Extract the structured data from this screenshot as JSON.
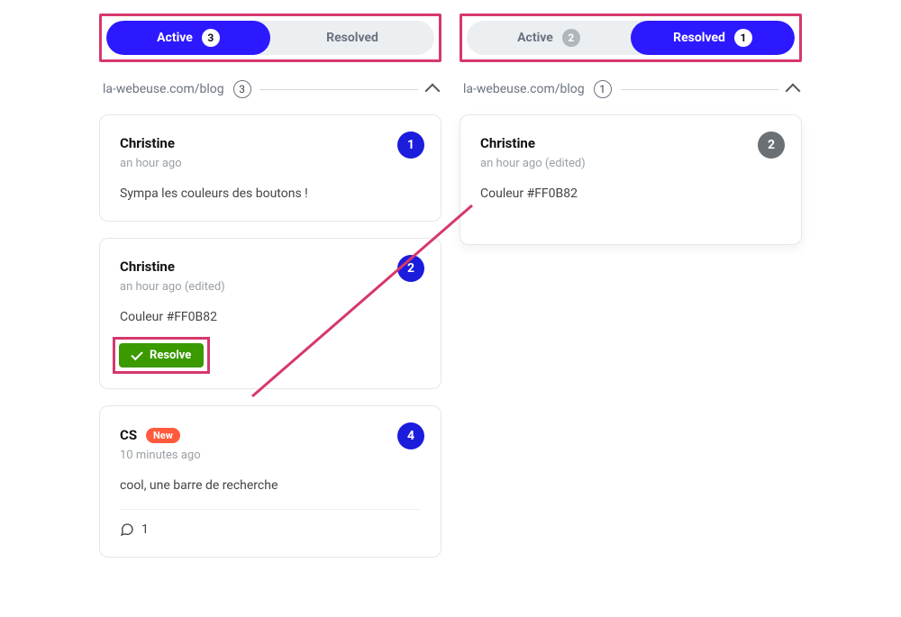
{
  "left": {
    "tabs": {
      "active_label": "Active",
      "active_count": "3",
      "resolved_label": "Resolved"
    },
    "page": {
      "url": "la-webeuse.com/blog",
      "count": "3"
    },
    "cards": [
      {
        "author": "Christine",
        "meta": "an hour ago",
        "body": "Sympa les couleurs des boutons !",
        "num": "1"
      },
      {
        "author": "Christine",
        "meta": "an hour ago (edited)",
        "body": "Couleur #FF0B82",
        "num": "2",
        "resolve_label": "Resolve"
      },
      {
        "author": "CS",
        "new_label": "New",
        "meta": "10 minutes ago",
        "body": "cool, une barre de recherche",
        "num": "4",
        "replies": "1"
      }
    ]
  },
  "right": {
    "tabs": {
      "active_label": "Active",
      "active_count": "2",
      "resolved_label": "Resolved",
      "resolved_count": "1"
    },
    "page": {
      "url": "la-webeuse.com/blog",
      "count": "1"
    },
    "cards": [
      {
        "author": "Christine",
        "meta": "an hour ago (edited)",
        "body": "Couleur #FF0B82",
        "num": "2"
      }
    ]
  }
}
